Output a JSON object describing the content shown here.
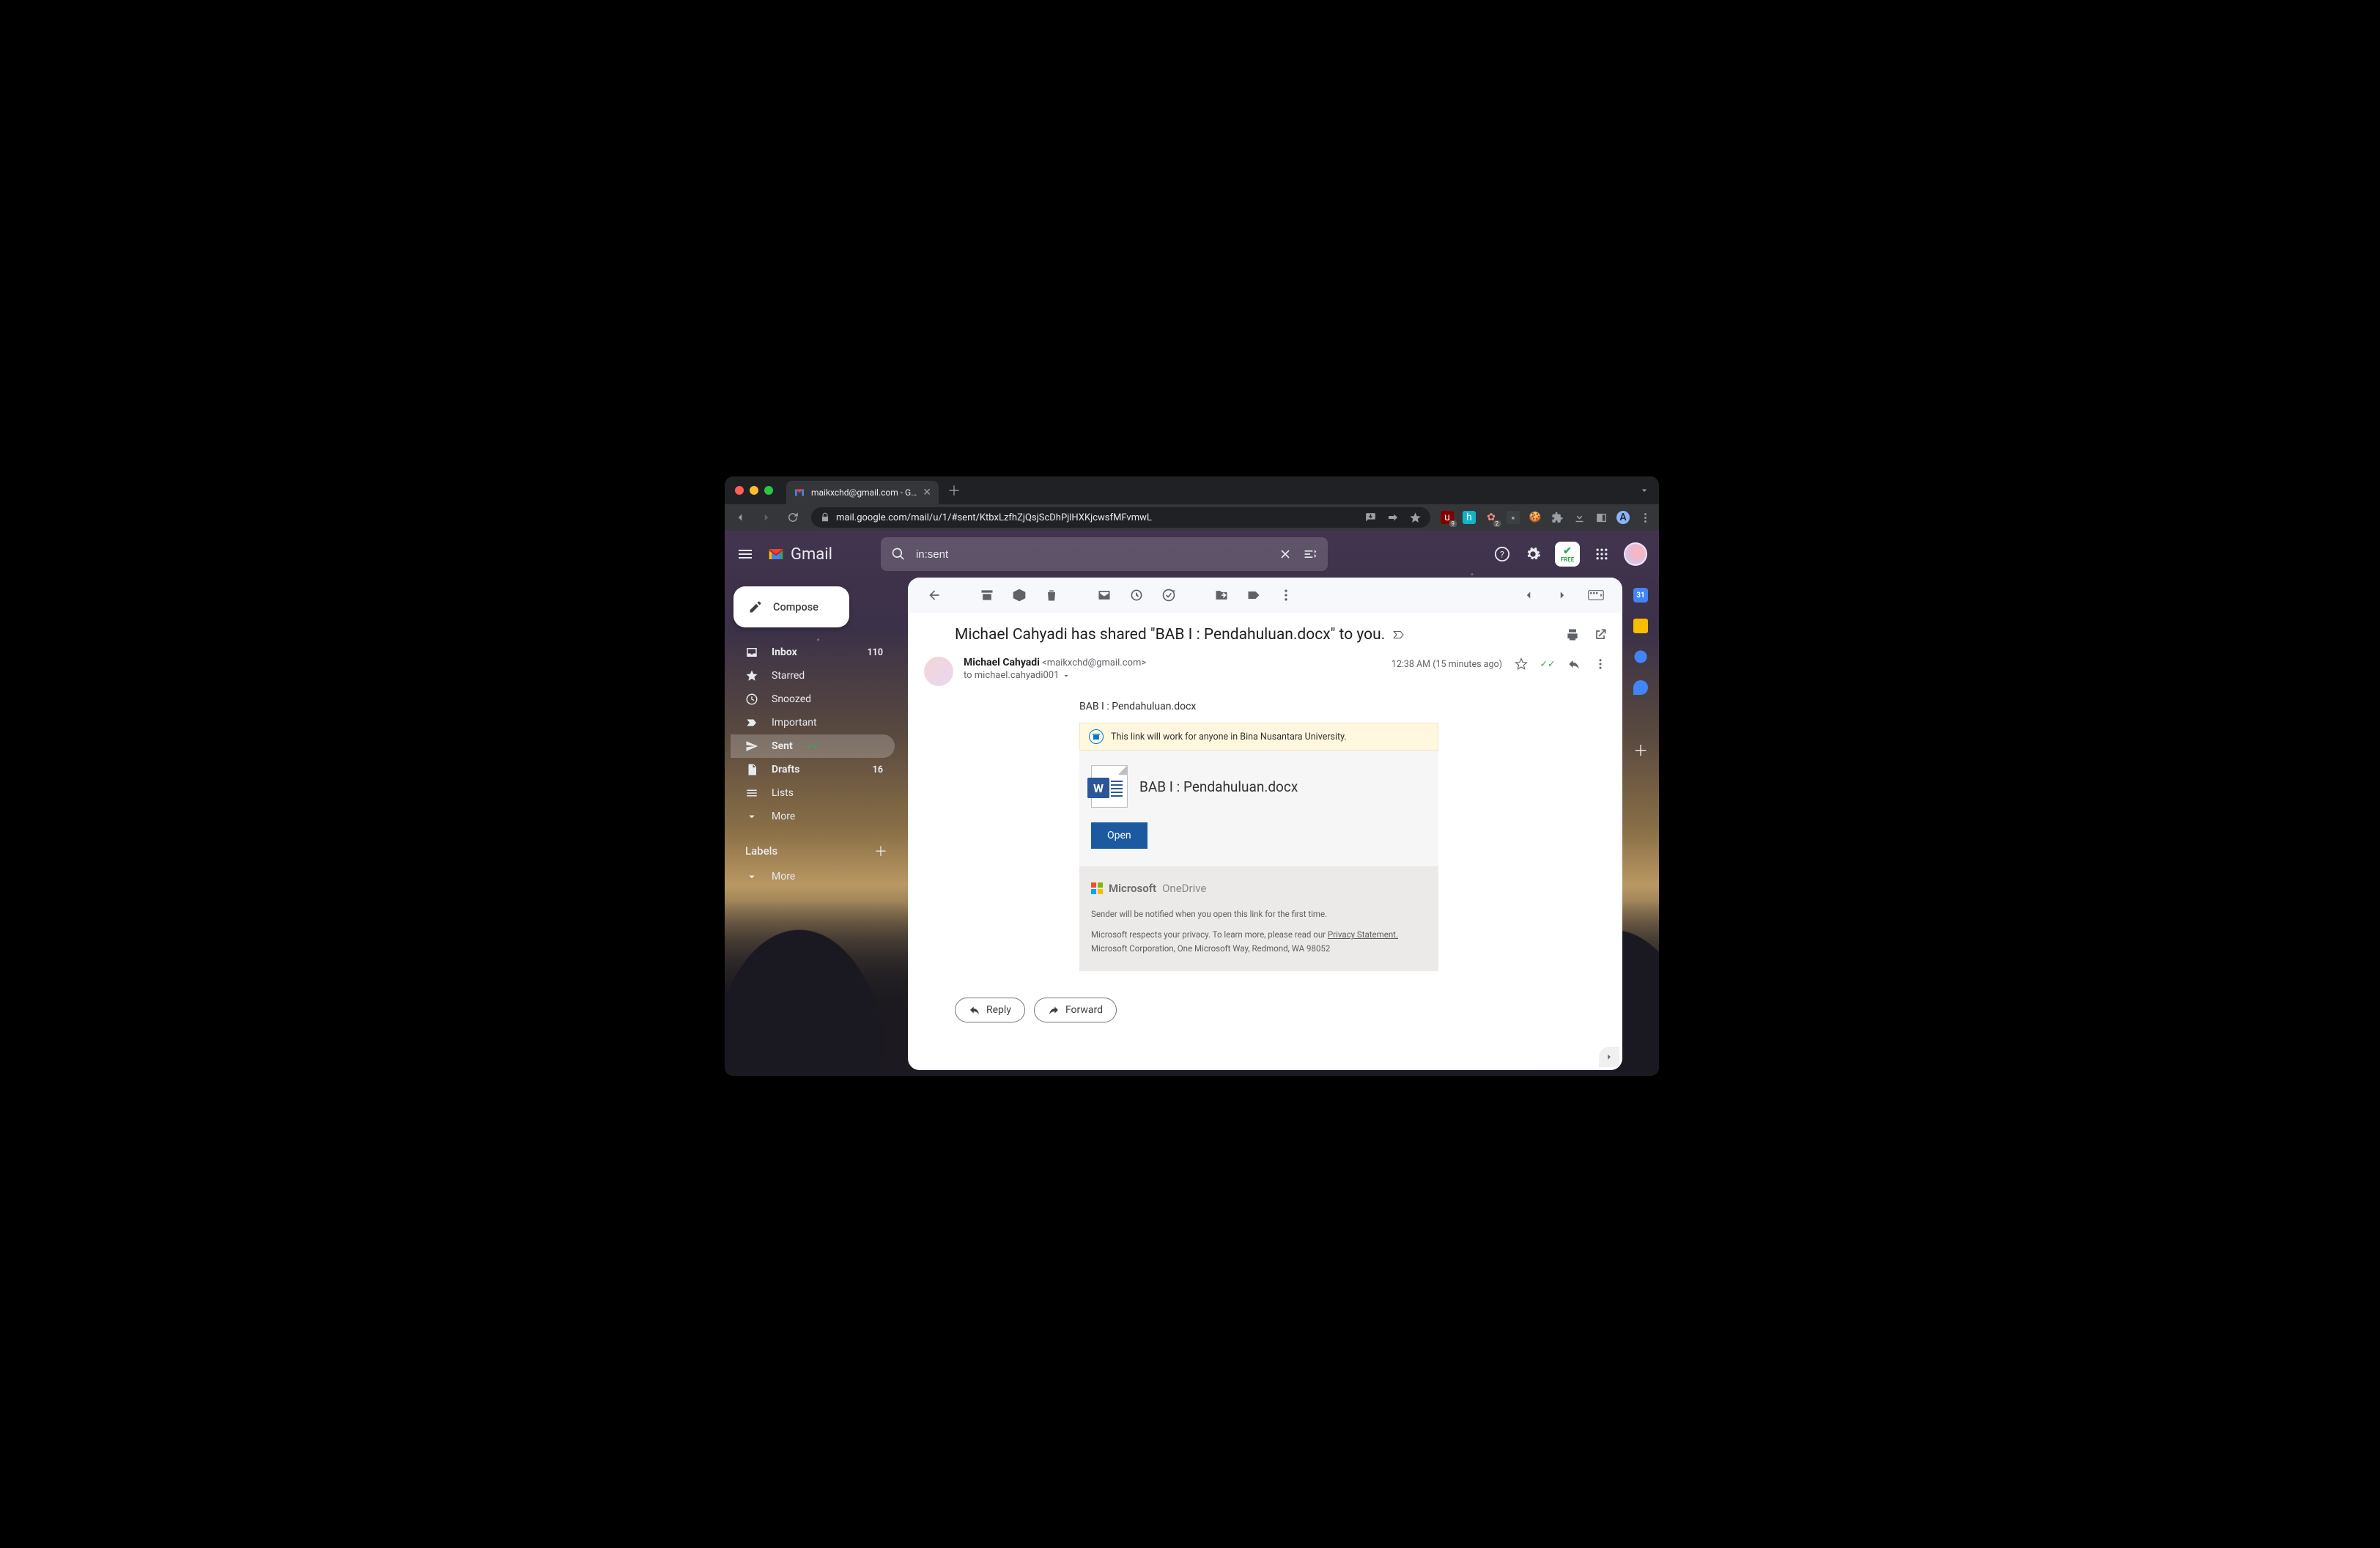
{
  "browser": {
    "tab_title": "maikxchd@gmail.com - G…",
    "url": "mail.google.com/mail/u/1/#sent/KtbxLzfhZjQsjScDhPjlHXKjcwsfMFvmwL",
    "avatar_initial": "A",
    "ext_badges": {
      "ublock": "9",
      "other": "2"
    }
  },
  "header": {
    "product": "Gmail",
    "search_value": "in:sent",
    "free_label": "FREE"
  },
  "sidebar": {
    "compose": "Compose",
    "items": [
      {
        "label": "Inbox",
        "count": "110",
        "bold": true
      },
      {
        "label": "Starred",
        "count": ""
      },
      {
        "label": "Snoozed",
        "count": ""
      },
      {
        "label": "Important",
        "count": ""
      },
      {
        "label": "Sent",
        "count": "",
        "active": true
      },
      {
        "label": "Drafts",
        "count": "16",
        "bold": true
      },
      {
        "label": "Lists",
        "count": ""
      },
      {
        "label": "More",
        "count": ""
      }
    ],
    "labels_header": "Labels",
    "labels_more": "More"
  },
  "message": {
    "subject": "Michael Cahyadi has shared \"BAB I : Pendahuluan.docx\" to you.",
    "sender_name": "Michael Cahyadi",
    "sender_email": "<maikxchd@gmail.com>",
    "to_line": "to michael.cahyadi001",
    "timestamp": "12:38 AM (15 minutes ago)"
  },
  "body": {
    "filename_top": "BAB I : Pendahuluan.docx",
    "banner_text": "This link will work for anyone in Bina Nusantara University.",
    "file_name": "BAB I : Pendahuluan.docx",
    "open_label": "Open",
    "ms_brand": "Microsoft",
    "od_brand": "OneDrive",
    "notify_text": "Sender will be notified when you open this link for the first time.",
    "privacy_pre": "Microsoft respects your privacy. To learn more, please read our ",
    "privacy_link": "Privacy Statement.",
    "corp_line": "Microsoft Corporation, One Microsoft Way, Redmond, WA 98052"
  },
  "actions": {
    "reply": "Reply",
    "forward": "Forward"
  }
}
